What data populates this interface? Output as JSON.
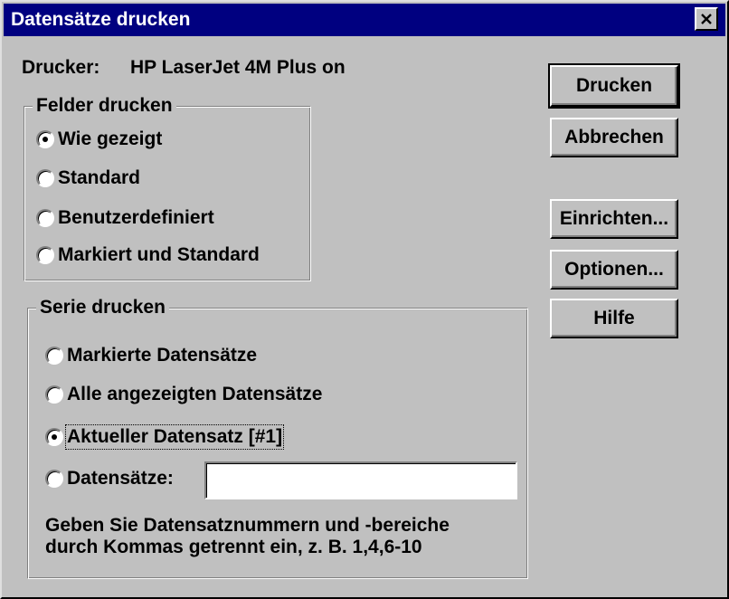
{
  "window": {
    "title": "Datensätze drucken"
  },
  "printer": {
    "label": "Drucker:",
    "name": "HP LaserJet 4M Plus on"
  },
  "felder_drucken": {
    "label": "Felder drucken",
    "options": [
      {
        "label": "Wie gezeigt",
        "checked": true
      },
      {
        "label": "Standard",
        "checked": false
      },
      {
        "label": "Benutzerdefiniert",
        "checked": false
      },
      {
        "label": "Markiert und Standard",
        "checked": false
      }
    ]
  },
  "serie_drucken": {
    "label": "Serie drucken",
    "options": [
      {
        "label": "Markierte Datensätze",
        "checked": false
      },
      {
        "label": "Alle angezeigten Datensätze",
        "checked": false
      },
      {
        "label": "Aktueller Datensatz [#1]",
        "checked": true
      },
      {
        "label": "Datensätze:",
        "checked": false
      }
    ],
    "range_value": "",
    "hint_line1": "Geben Sie Datensatznummern und -bereiche",
    "hint_line2": "durch Kommas getrennt ein, z. B. 1,4,6-10"
  },
  "buttons": {
    "print": "Drucken",
    "cancel": "Abbrechen",
    "setup": "Einrichten...",
    "options": "Optionen...",
    "help": "Hilfe"
  },
  "icons": {
    "close": "close-icon"
  }
}
